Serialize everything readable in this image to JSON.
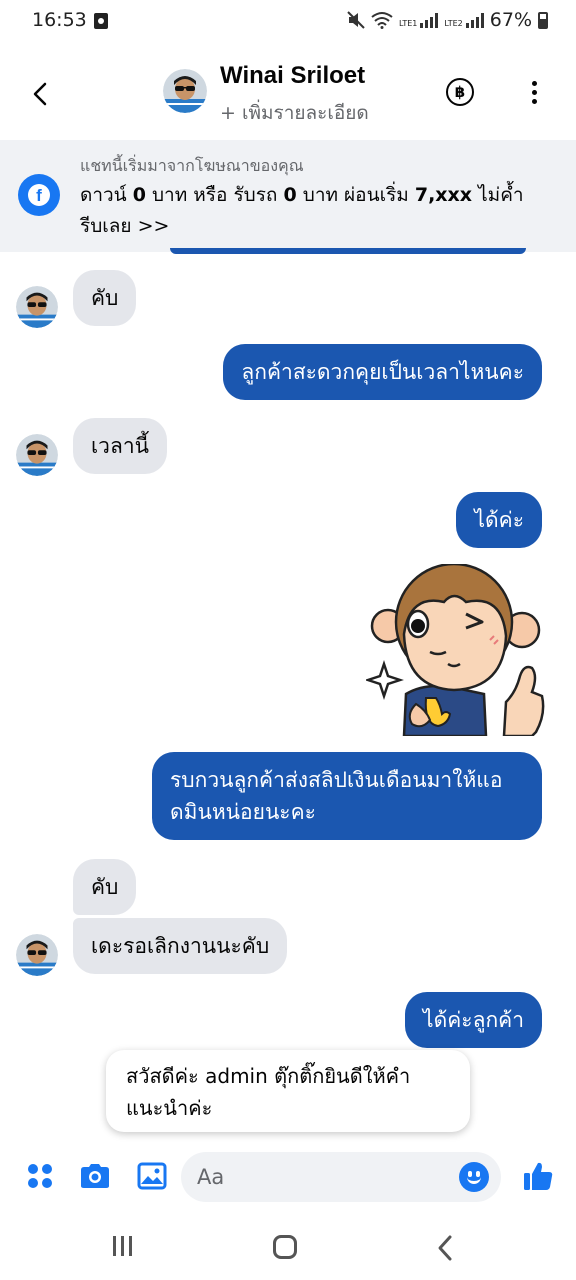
{
  "status_bar": {
    "time": "16:53",
    "battery": "67%",
    "sim1": "LTE1",
    "sim2": "LTE2",
    "icons": [
      "media-icon",
      "mute-icon",
      "wifi-icon",
      "signal-icon",
      "battery-icon"
    ]
  },
  "header": {
    "name": "Winai Sriloet",
    "subtitle": "+ เพิ่มรายละเอียด",
    "baht_symbol": "฿",
    "icons": [
      "back-arrow-icon",
      "baht-icon",
      "more-vertical-icon"
    ]
  },
  "ad_banner": {
    "caption": "แชทนี้เริ่มมาจากโฆษณาของคุณ",
    "text_part1": "ดาวน์ ",
    "bold1": "0",
    "text_part2": " บาท หรือ รับรถ ",
    "bold2": "0",
    "text_part3": " บาท ผ่อนเริ่ม ",
    "bold3": "7,xxx",
    "text_part4": " ไม่ค้ำ รีบเลย >>"
  },
  "messages": [
    {
      "sender": "contact",
      "text": "คับ"
    },
    {
      "sender": "me",
      "text": "ลูกค้าสะดวกคุยเป็นเวลาไหนคะ"
    },
    {
      "sender": "contact",
      "text": "เวลานี้"
    },
    {
      "sender": "me",
      "text": "ได้ค่ะ"
    },
    {
      "sender": "me",
      "sticker": "monkey-thumbs-up-sticker"
    },
    {
      "sender": "me",
      "text": "รบกวนลูกค้าส่งสลิปเงินเดือนมาให้แอดมินหน่อยนะคะ"
    },
    {
      "sender": "contact",
      "text": "คับ"
    },
    {
      "sender": "contact",
      "text": "เดะรอเลิกงานนะคับ"
    },
    {
      "sender": "me",
      "text": "ได้ค่ะลูกค้า"
    }
  ],
  "quick_reply": {
    "text": "สวัสดีค่ะ admin ตุ๊กติ๊กยินดีให้คำแนะนำค่ะ"
  },
  "composer": {
    "placeholder": "Aa",
    "icons": [
      "apps-icon",
      "camera-icon",
      "gallery-icon",
      "emoji-icon",
      "like-icon"
    ],
    "accent": "#1877f2"
  },
  "colors": {
    "outgoing_bubble": "#1b57b0",
    "incoming_bubble": "#e4e6eb",
    "banner_bg": "#f0f2f5",
    "messenger_blue": "#1877f2"
  },
  "nav_bar": {
    "icons": [
      "recents-icon",
      "home-icon",
      "nav-back-icon"
    ]
  }
}
